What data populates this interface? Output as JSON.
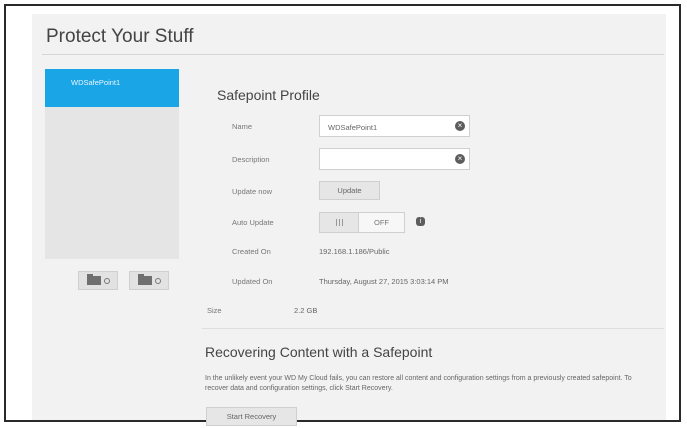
{
  "page": {
    "title": "Protect Your Stuff"
  },
  "safepoints": {
    "items": [
      {
        "label": "WDSafePoint1"
      }
    ]
  },
  "profile": {
    "title": "Safepoint Profile",
    "name_label": "Name",
    "name_value": "WDSafePoint1",
    "description_label": "Description",
    "description_value": "",
    "update_now_label": "Update now",
    "update_button": "Update",
    "auto_update_label": "Auto Update",
    "auto_update_state": "OFF",
    "created_on_label": "Created On",
    "created_on_value": "192.168.1.186/Public",
    "updated_on_label": "Updated On",
    "updated_on_value": "Thursday, August 27, 2015 3:03:14 PM",
    "size_label": "Size",
    "size_value": "2.2 GB"
  },
  "recovery": {
    "title": "Recovering Content with a Safepoint",
    "description": "In the unlikely event your WD My Cloud fails, you can restore all content and configuration settings from a previously created safepoint. To recover data and configuration settings, click Start Recovery.",
    "button": "Start Recovery"
  },
  "icons": {
    "clear": "clear-circle-icon",
    "info": "info-icon",
    "folder": "folder-gear-icon"
  },
  "colors": {
    "accent": "#1aa5e6"
  }
}
